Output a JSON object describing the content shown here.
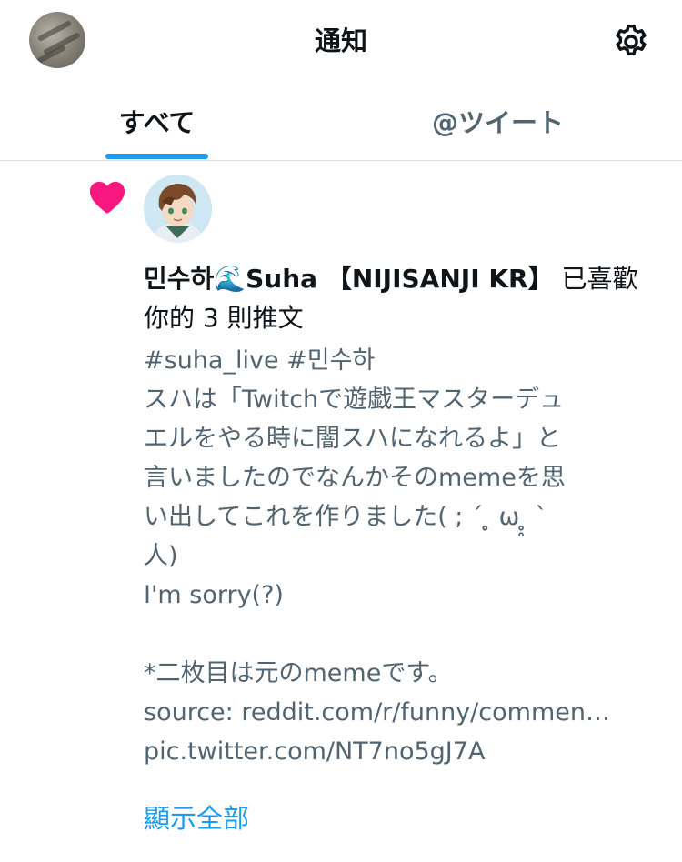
{
  "header": {
    "title": "通知"
  },
  "tabs": [
    {
      "label": "すべて",
      "active": true
    },
    {
      "label": "@ツイート",
      "active": false
    }
  ],
  "colors": {
    "accent": "#1d9bf0",
    "like_heart": "#f91880",
    "text_primary": "#0f1419",
    "text_secondary": "#536471"
  },
  "notification": {
    "type_icon": "heart-icon",
    "user_name": "민수하🌊Suha 【NIJISANJI KR】",
    "action": " 已喜歡你的 3 則推文",
    "tweet_lines": [
      "#suha_live #민수하",
      "スハは「Twitchで遊戯王マスターデュ",
      "エルをやる時に闇スハになれるよ」と",
      "言いましたのでなんかそのmemeを思",
      "い出してこれを作りました( ; ´ ̥̥̥ ω ̥̥̥ ` ",
      "人)",
      "I'm sorry(?)",
      "",
      "*二枚目は元のmemeです。",
      "source: reddit.com/r/funny/commen…",
      "pic.twitter.com/NT7no5gJ7A"
    ],
    "show_all_label": "顯示全部"
  }
}
